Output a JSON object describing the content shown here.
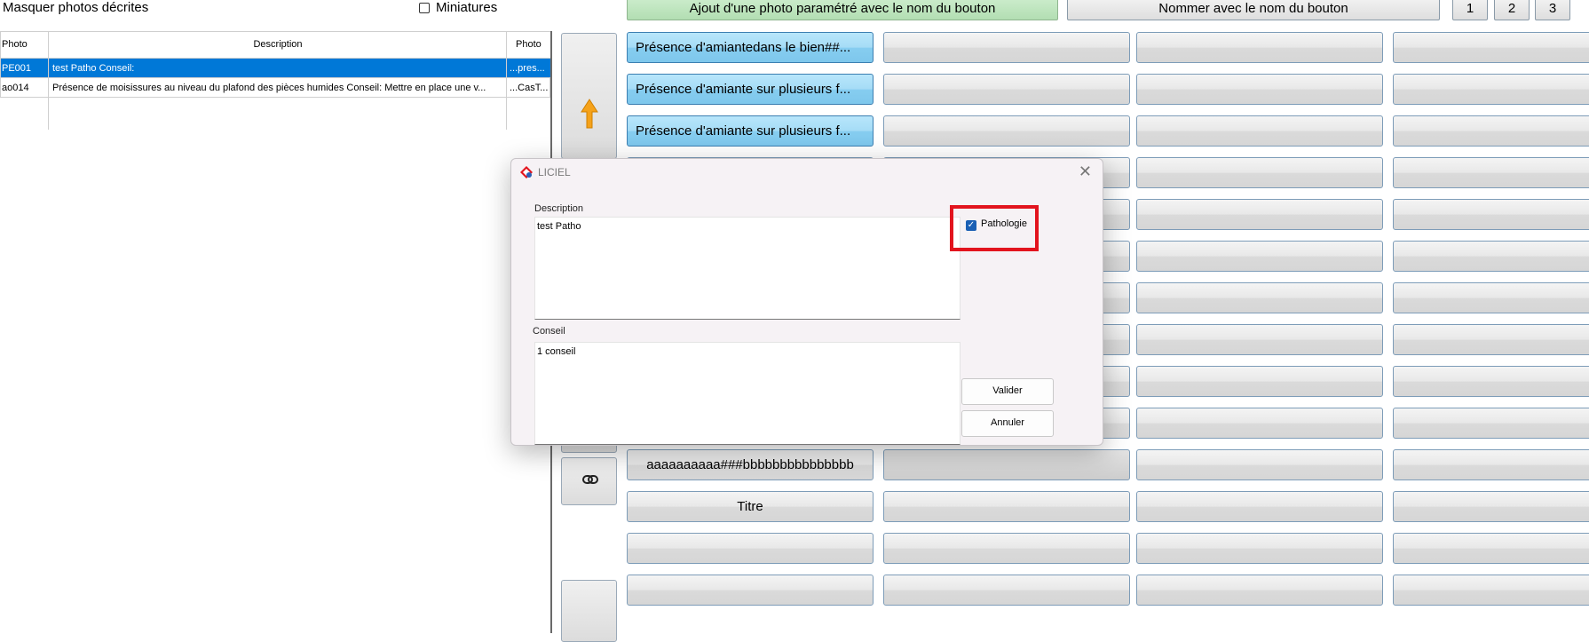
{
  "toolbar": {
    "hide_described_label": "Masquer photos décrites",
    "thumbnails_label": "Miniatures",
    "add_photo_button": "Ajout d'une photo paramétré avec le nom du bouton",
    "rename_button": "Nommer avec le nom du bouton",
    "pages": [
      "1",
      "2",
      "3"
    ]
  },
  "table": {
    "columns": [
      "Photo",
      "Description",
      "Photo"
    ],
    "rows": [
      {
        "photo": "PE001",
        "description": "test Patho Conseil:",
        "photo2": "...pres...",
        "selected": true
      },
      {
        "photo": "ao014",
        "description": "Présence de moisissures au niveau du plafond des pièces humides Conseil: Mettre en place une v...",
        "photo2": "...CasT...",
        "selected": false
      }
    ]
  },
  "side": {
    "up_arrow_icon": "arrow-up-icon",
    "link_icon": "link-icon"
  },
  "grid": {
    "col1": [
      "Présence d'amiantedans le bien##...",
      "Présence d'amiante sur plusieurs f...",
      "Présence d'amiante sur plusieurs f...",
      "",
      "",
      "",
      "",
      "",
      "",
      "",
      "aaaaaaaaaa###bbbbbbbbbbbbbbb",
      "Titre",
      "",
      ""
    ]
  },
  "dialog": {
    "title": "LICIEL",
    "close_symbol": "✕",
    "description_label": "Description",
    "description_value": "test Patho",
    "conseil_label": "Conseil",
    "conseil_value": "1 conseil",
    "pathologie_label": "Pathologie",
    "pathologie_checked": true,
    "validate_button": "Valider",
    "cancel_button": "Annuler",
    "accent_color": "#e2141e"
  }
}
